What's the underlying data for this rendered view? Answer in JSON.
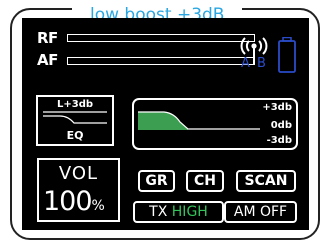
{
  "caption": "low boost +3dB",
  "meters": {
    "rf_label": "RF",
    "af_label": "AF",
    "rf_level": 0.0,
    "af_level": 0.0
  },
  "diversity": {
    "a_label": "A",
    "b_label": "B"
  },
  "eq": {
    "setting": "L+3db",
    "label": "EQ"
  },
  "graph": {
    "plus_label": "+3db",
    "zero_label": "0db",
    "minus_label": "-3db",
    "fill_color": "#3c9e50"
  },
  "volume": {
    "label": "VOL",
    "value": "100",
    "unit": "%"
  },
  "buttons": {
    "gr": "GR",
    "ch": "CH",
    "scan": "SCAN",
    "tx_prefix": "TX",
    "tx_value": "HIGH",
    "am": "AM OFF"
  },
  "colors": {
    "caption": "#2aa7e2",
    "screen": "#000000",
    "tx_high": "#32c45a",
    "ab": "#2a4cc8",
    "battery": "#2a4cc8"
  },
  "icons": {
    "antenna": "antenna-signal-icon",
    "battery": "battery-icon"
  }
}
